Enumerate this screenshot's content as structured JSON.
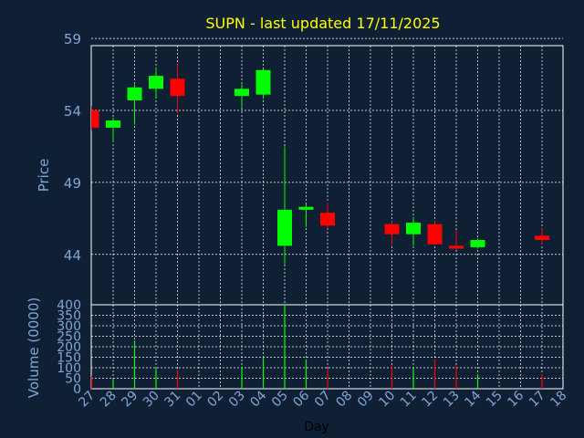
{
  "chart_data": {
    "type": "candlestick",
    "title": "SUPN - last updated 17/11/2025",
    "colors": {
      "background": "#0f2035",
      "up": "#00ff00",
      "down": "#ff0000",
      "title": "#ffff00",
      "axis_text": "#7ea6d6",
      "grid": "#ffffff"
    },
    "price_panel": {
      "ylabel": "Price",
      "ylim": [
        40.5,
        58.5
      ],
      "yticks": [
        44,
        49,
        54,
        59
      ]
    },
    "volume_panel": {
      "ylabel": "Volume (0000)",
      "ylim": [
        0,
        400
      ],
      "yticks": [
        0,
        50,
        100,
        150,
        200,
        250,
        300,
        350,
        400
      ]
    },
    "xlabel": "Day",
    "x_tick_labels": [
      "27",
      "28",
      "29",
      "30",
      "31",
      "01",
      "02",
      "03",
      "04",
      "05",
      "06",
      "07",
      "08",
      "09",
      "10",
      "11",
      "12",
      "13",
      "14",
      "15",
      "16",
      "17",
      "18"
    ],
    "candles": [
      {
        "day": "27",
        "open": 54.0,
        "high": 54.3,
        "low": 52.6,
        "close": 52.8,
        "volume": 60
      },
      {
        "day": "28",
        "open": 52.8,
        "high": 53.5,
        "low": 51.8,
        "close": 53.3,
        "volume": 50
      },
      {
        "day": "29",
        "open": 54.7,
        "high": 55.8,
        "low": 53.0,
        "close": 55.6,
        "volume": 230
      },
      {
        "day": "30",
        "open": 55.5,
        "high": 57.0,
        "low": 54.9,
        "close": 56.4,
        "volume": 95
      },
      {
        "day": "31",
        "open": 56.2,
        "high": 57.2,
        "low": 53.8,
        "close": 55.0,
        "volume": 90
      },
      {
        "day": "03",
        "open": 55.0,
        "high": 55.8,
        "low": 54.2,
        "close": 55.5,
        "volume": 105
      },
      {
        "day": "04",
        "open": 55.1,
        "high": 56.9,
        "low": 54.8,
        "close": 56.8,
        "volume": 150
      },
      {
        "day": "05",
        "open": 44.6,
        "high": 51.5,
        "low": 43.3,
        "close": 47.1,
        "volume": 400
      },
      {
        "day": "06",
        "open": 47.1,
        "high": 47.5,
        "low": 45.9,
        "close": 47.3,
        "volume": 140
      },
      {
        "day": "07",
        "open": 46.9,
        "high": 47.6,
        "low": 45.8,
        "close": 46.0,
        "volume": 95
      },
      {
        "day": "10",
        "open": 46.1,
        "high": 46.3,
        "low": 44.6,
        "close": 45.4,
        "volume": 110
      },
      {
        "day": "11",
        "open": 45.4,
        "high": 46.6,
        "low": 44.6,
        "close": 46.2,
        "volume": 105
      },
      {
        "day": "12",
        "open": 46.1,
        "high": 46.3,
        "low": 44.7,
        "close": 44.7,
        "volume": 140
      },
      {
        "day": "13",
        "open": 44.6,
        "high": 45.7,
        "low": 44.3,
        "close": 44.4,
        "volume": 110
      },
      {
        "day": "14",
        "open": 44.5,
        "high": 45.1,
        "low": 44.4,
        "close": 45.0,
        "volume": 70
      },
      {
        "day": "17",
        "open": 45.3,
        "high": 45.8,
        "low": 44.7,
        "close": 45.0,
        "volume": 70
      }
    ]
  }
}
